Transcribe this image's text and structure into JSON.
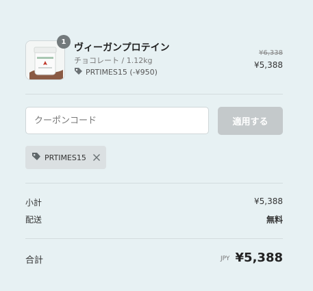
{
  "product": {
    "quantity": "1",
    "name": "ヴィーガンプロテイン",
    "variant": "チョコレート / 1.12kg",
    "discount": "PRTIMES15 (-¥950)",
    "price_original": "¥6,338",
    "price_final": "¥5,388",
    "image_icon": "protein-jar-image"
  },
  "coupon": {
    "placeholder": "クーポンコード",
    "apply_label": "適用する",
    "applied_code": "PRTIMES15"
  },
  "summary": {
    "subtotal_label": "小計",
    "subtotal_value": "¥5,388",
    "shipping_label": "配送",
    "shipping_value": "無料",
    "total_label": "合計",
    "currency": "JPY",
    "total_value": "¥5,388"
  },
  "colors": {
    "background": "#e7f1f3",
    "button_disabled": "#c4c9cb",
    "tag_background": "#dbe0e2"
  }
}
